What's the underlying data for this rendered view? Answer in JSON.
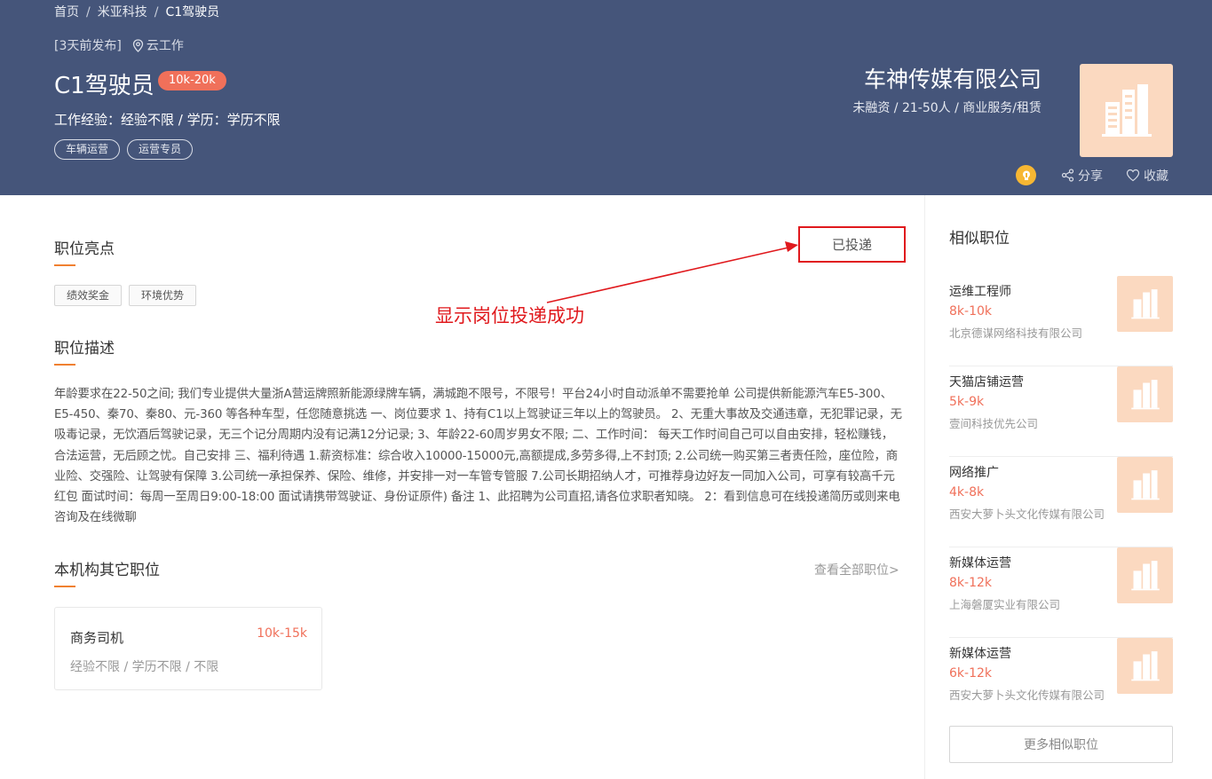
{
  "breadcrumb": {
    "items": [
      "首页",
      "米亚科技",
      "C1驾驶员"
    ],
    "separator": "/"
  },
  "job": {
    "posted": "[3天前发布]",
    "location": "云工作",
    "title": "C1驾驶员",
    "salary": "10k-20k",
    "requirements": "工作经验：经验不限 / 学历：学历不限",
    "tags": [
      "车辆运营",
      "运营专员"
    ]
  },
  "company": {
    "name": "车神传媒有限公司",
    "meta": "未融资 / 21-50人 / 商业服务/租赁"
  },
  "actions": {
    "share": "分享",
    "favorite": "收藏"
  },
  "highlights": {
    "title": "职位亮点",
    "chips": [
      "绩效奖金",
      "环境优势"
    ],
    "applied_label": "已投递",
    "annotation": "显示岗位投递成功"
  },
  "description": {
    "title": "职位描述",
    "text": "年龄要求在22-50之间; 我们专业提供大量浙A营运牌照新能源绿牌车辆，满城跑不限号，不限号！平台24小时自动派单不需要抢单 公司提供新能源汽车E5-300、E5-450、秦70、秦80、元-360 等各种车型，任您随意挑选 一、岗位要求 1、持有C1以上驾驶证三年以上的驾驶员。 2、无重大事故及交通违章，无犯罪记录，无吸毒记录，无饮酒后驾驶记录，无三个记分周期内没有记满12分记录; 3、年龄22-60周岁男女不限; 二、工作时间： 每天工作时间自己可以自由安排，轻松赚钱，合法运营，无后顾之忧。自己安排 三、福利待遇 1.薪资标准：综合收入10000-15000元,高额提成,多劳多得,上不封顶; 2.公司统一购买第三者责任险，座位险，商业险、交强险、让驾驶有保障 3.公司统一承担保养、保险、维修，并安排一对一车管专管服 7.公司长期招纳人才，可推荐身边好友一同加入公司，可享有较高千元红包 面试时间：每周一至周日9:00-18:00 面试请携带驾驶证、身份证原件) 备注 1、此招聘为公司直招,请各位求职者知晓。 2：看到信息可在线投递简历或则来电咨询及在线微聊"
  },
  "other_jobs": {
    "title": "本机构其它职位",
    "view_all": "查看全部职位>",
    "items": [
      {
        "title": "商务司机",
        "salary": "10k-15k",
        "meta": "经验不限 / 学历不限 / 不限"
      }
    ]
  },
  "similar": {
    "title": "相似职位",
    "more": "更多相似职位",
    "items": [
      {
        "title": "运维工程师",
        "salary": "8k-10k",
        "company": "北京德谋网络科技有限公司"
      },
      {
        "title": "天猫店铺运营",
        "salary": "5k-9k",
        "company": "壹间科技优先公司"
      },
      {
        "title": "网络推广",
        "salary": "4k-8k",
        "company": "西安大萝卜头文化传媒有限公司"
      },
      {
        "title": "新媒体运营",
        "salary": "8k-12k",
        "company": "上海磐厦实业有限公司"
      },
      {
        "title": "新媒体运营",
        "salary": "6k-12k",
        "company": "西安大萝卜头文化传媒有限公司"
      }
    ]
  },
  "colors": {
    "header_bg": "#45557a",
    "accent_orange": "#f08030",
    "salary_red": "#f0705a",
    "annotation_red": "#e0191d",
    "logo_bg": "#fbd9c0"
  }
}
